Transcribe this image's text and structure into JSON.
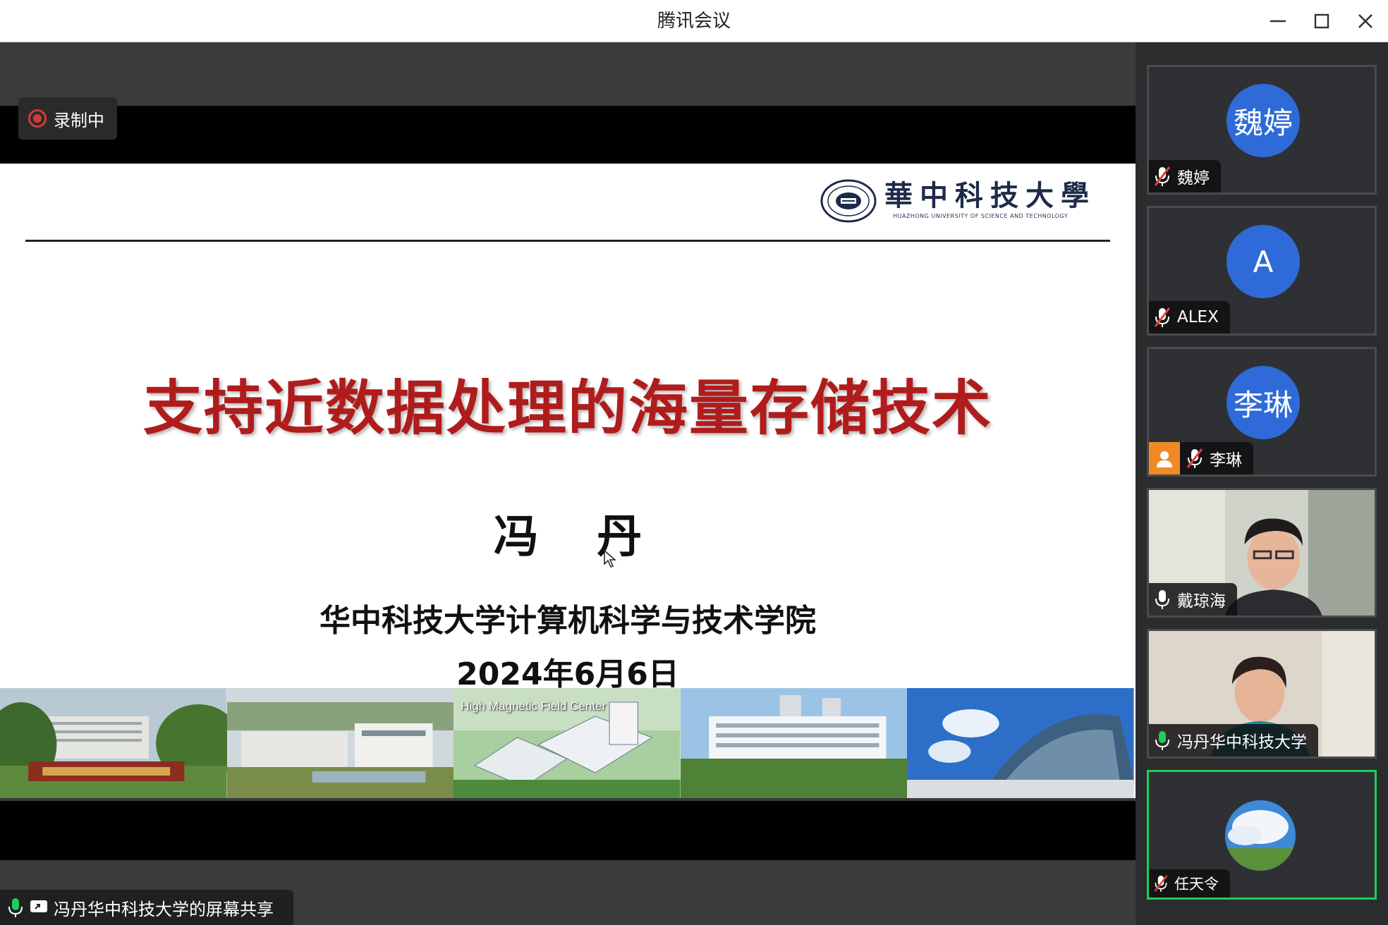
{
  "window": {
    "title": "腾讯会议",
    "minimize_icon": "minimize-icon",
    "maximize_icon": "maximize-icon",
    "close_icon": "close-icon"
  },
  "recording": {
    "label": "录制中",
    "color": "#d23a3a"
  },
  "slide": {
    "logo_text_cn": "華中科技大學",
    "logo_text_en": "HUAZHONG UNIVERSITY OF SCIENCE AND TECHNOLOGY",
    "title": "支持近数据处理的海量存储技术",
    "title_color": "#b01c1c",
    "author": "冯 丹",
    "affiliation": "华中科技大学计算机科学与技术学院",
    "date": "2024年6月6日",
    "photo_caption": "High Magnetic Field Center"
  },
  "share_label": "冯丹华中科技大学的屏幕共享",
  "participants": [
    {
      "name": "魏婷",
      "avatar_text": "魏婷",
      "mic": "muted",
      "type": "avatar"
    },
    {
      "name": "ALEX",
      "avatar_text": "A",
      "mic": "muted",
      "type": "avatar"
    },
    {
      "name": "李琳",
      "avatar_text": "李琳",
      "mic": "muted",
      "type": "avatar",
      "host": true
    },
    {
      "name": "戴琼海",
      "mic": "on",
      "type": "video"
    },
    {
      "name": "冯丹华中科技大学",
      "mic": "on",
      "type": "video"
    },
    {
      "name": "任天令",
      "mic": "muted",
      "type": "photo-avatar",
      "active_speaker": true
    }
  ],
  "colors": {
    "avatar_blue": "#2f6bd8",
    "active_border": "#1ccf57",
    "host_badge": "#f08a24"
  }
}
